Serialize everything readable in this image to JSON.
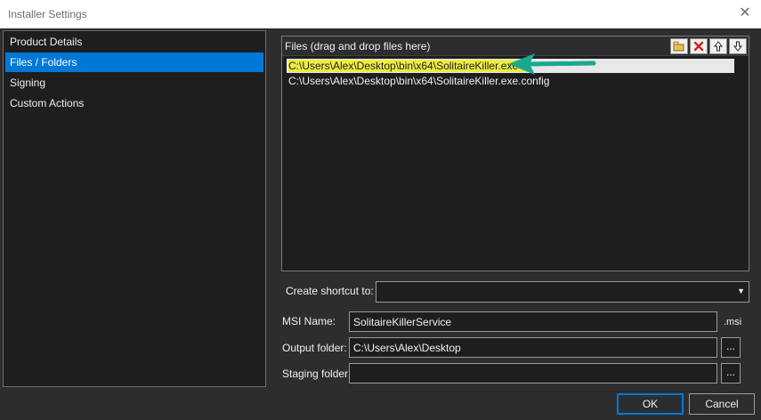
{
  "window": {
    "title": "Installer Settings",
    "close_icon": "close-icon"
  },
  "nav": {
    "items": [
      {
        "label": "Product Details"
      },
      {
        "label": "Files / Folders",
        "selected": true
      },
      {
        "label": "Signing"
      },
      {
        "label": "Custom Actions"
      }
    ]
  },
  "files": {
    "header": "Files (drag and drop files here)",
    "toolbar": {
      "add_folder_icon": "add-folder-icon",
      "remove_icon": "remove-icon",
      "move_up_icon": "move-up-icon",
      "move_down_icon": "move-down-icon"
    },
    "items": [
      {
        "path": "C:\\Users\\Alex\\Desktop\\bin\\x64\\SolitaireKiller.exe",
        "selected": true
      },
      {
        "path": "C:\\Users\\Alex\\Desktop\\bin\\x64\\SolitaireKiller.exe.config"
      }
    ],
    "annotation_arrow_color": "#1aa88e",
    "highlight_color": "#ecec45"
  },
  "form": {
    "shortcut_label": "Create shortcut to:",
    "shortcut_value": "",
    "msi_label": "MSI Name:",
    "msi_value": "SolitaireKillerService",
    "msi_suffix": ".msi",
    "output_label": "Output folder:",
    "output_value": "C:\\Users\\Alex\\Desktop",
    "staging_label": "Staging folder:",
    "staging_value": "",
    "browse_label": "..."
  },
  "footer": {
    "ok_label": "OK",
    "cancel_label": "Cancel"
  },
  "colors": {
    "background": "#2d2d30",
    "panel": "#1e1e1e",
    "accent": "#0078d7"
  }
}
